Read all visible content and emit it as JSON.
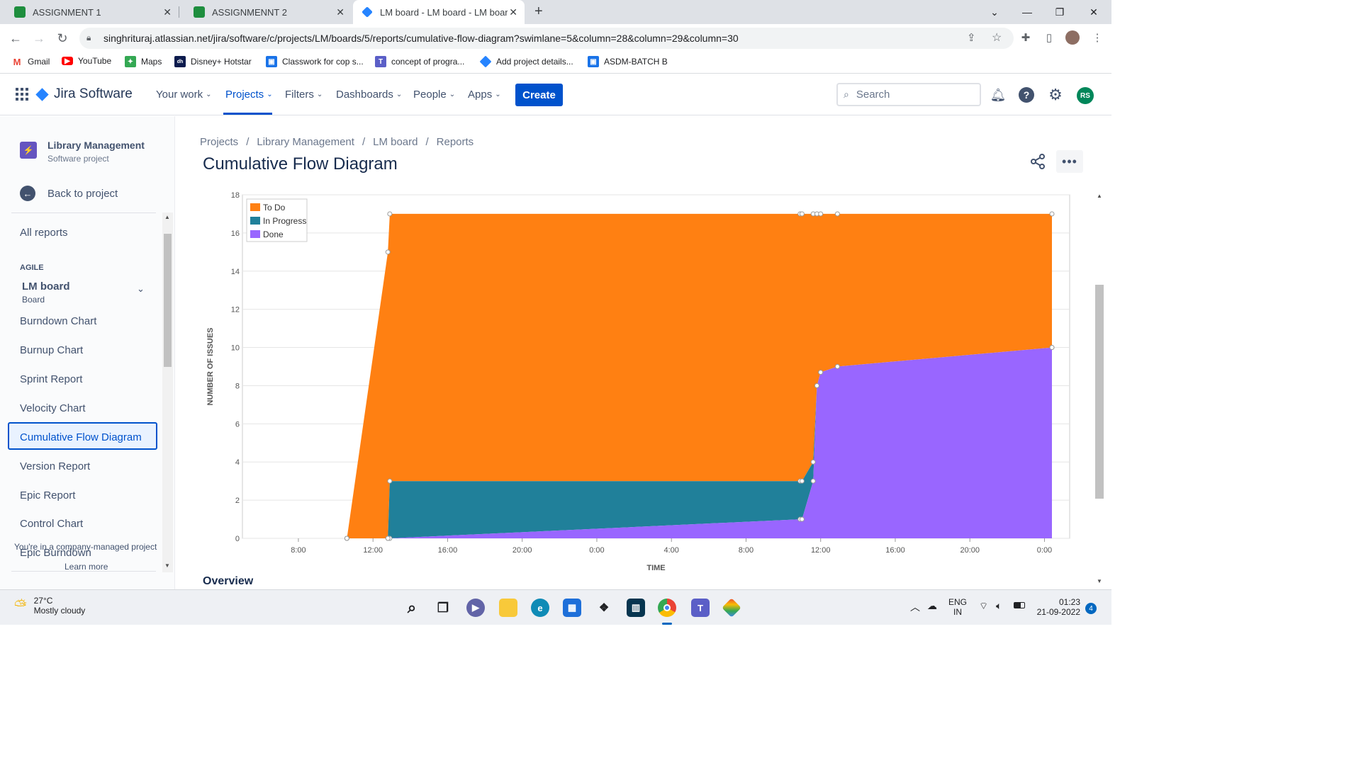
{
  "browser": {
    "tabs": [
      {
        "label": "ASSIGNMENT 1",
        "color": "#1a73e8"
      },
      {
        "label": "ASSIGNMENNT 2",
        "color": "#1a73e8"
      },
      {
        "label": "LM board - LM board - LM board",
        "color": "#2684ff"
      }
    ],
    "url": "singhrituraj.atlassian.net/jira/software/c/projects/LM/boards/5/reports/cumulative-flow-diagram?swimlane=5&column=28&column=29&column=30",
    "bookmarks": [
      {
        "label": "Gmail",
        "icon": "gmail-icon"
      },
      {
        "label": "YouTube",
        "icon": "youtube-icon"
      },
      {
        "label": "Maps",
        "icon": "maps-icon"
      },
      {
        "label": "Disney+ Hotstar",
        "icon": "hotstar-icon"
      },
      {
        "label": "Classwork for cop s...",
        "icon": "classroom-icon"
      },
      {
        "label": "concept of progra...",
        "icon": "teams-icon"
      },
      {
        "label": "Add project details...",
        "icon": "jira-icon"
      },
      {
        "label": "ASDM-BATCH B",
        "icon": "classroom-icon"
      }
    ]
  },
  "jira": {
    "product": "Jira Software",
    "nav": [
      {
        "label": "Your work"
      },
      {
        "label": "Projects"
      },
      {
        "label": "Filters"
      },
      {
        "label": "Dashboards"
      },
      {
        "label": "People"
      },
      {
        "label": "Apps"
      }
    ],
    "create_label": "Create",
    "search_placeholder": "Search",
    "avatar_initials": "RS"
  },
  "sidebar": {
    "project_name": "Library Management",
    "project_type": "Software project",
    "back_label": "Back to project",
    "all_reports": "All reports",
    "section_label": "AGILE",
    "board_name": "LM board",
    "board_type": "Board",
    "reports": [
      "Burndown Chart",
      "Burnup Chart",
      "Sprint Report",
      "Velocity Chart",
      "Cumulative Flow Diagram",
      "Version Report",
      "Epic Report",
      "Control Chart",
      "Epic Burndown"
    ],
    "footer_text": "You're in a company-managed project",
    "footer_link": "Learn more"
  },
  "main": {
    "breadcrumb": [
      "Projects",
      "Library Management",
      "LM board",
      "Reports"
    ],
    "title": "Cumulative Flow Diagram",
    "overview": "Overview"
  },
  "chart_data": {
    "type": "area",
    "xlabel": "TIME",
    "ylabel": "NUMBER OF ISSUES",
    "ylim": [
      0,
      18
    ],
    "yticks": [
      0,
      2,
      4,
      6,
      8,
      10,
      12,
      14,
      16,
      18
    ],
    "xticks": [
      "8:00",
      "12:00",
      "16:00",
      "20:00",
      "0:00",
      "4:00",
      "8:00",
      "12:00",
      "16:00",
      "20:00",
      "0:00"
    ],
    "legend_position": "top-left",
    "grid": true,
    "colors": {
      "To Do": "#ff8012",
      "In Progress": "#20809a",
      "Done": "#9966ff"
    },
    "x_hours": [
      10.6,
      12.8,
      12.9,
      34.9,
      35.0,
      35.6,
      35.8,
      36.0,
      36.9,
      48.4
    ],
    "series": [
      {
        "name": "Done",
        "values": [
          0,
          0,
          0,
          1,
          1,
          3,
          8,
          8.7,
          9,
          10
        ]
      },
      {
        "name": "In Progress",
        "values": [
          0,
          0,
          3,
          3,
          3,
          4,
          8,
          8.7,
          9,
          10
        ]
      },
      {
        "name": "To Do",
        "values": [
          0,
          15,
          17,
          17,
          17,
          17,
          17,
          17,
          17,
          17
        ]
      }
    ]
  },
  "taskbar": {
    "weather_temp": "27°C",
    "weather_desc": "Mostly cloudy",
    "lang": "ENG",
    "region": "IN",
    "time": "01:23",
    "date": "21-09-2022",
    "notifications": "4"
  }
}
